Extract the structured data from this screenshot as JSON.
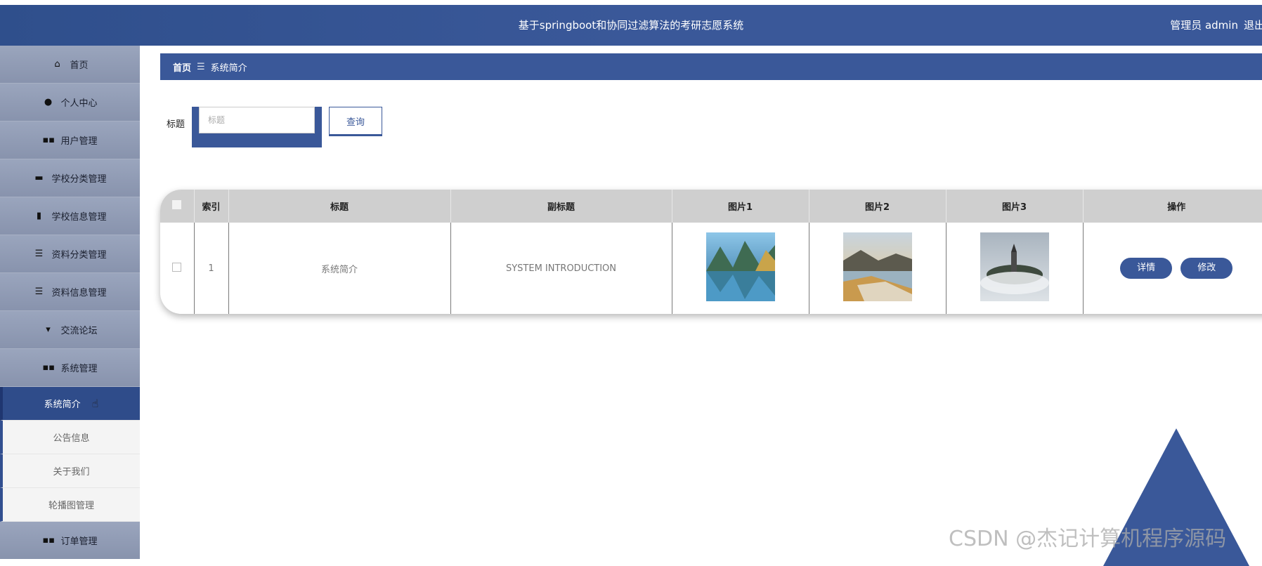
{
  "header": {
    "title": "基于springboot和协同过滤算法的考研志愿系统",
    "role": "管理员 admin",
    "logout": "退出"
  },
  "sidebar": {
    "items": [
      {
        "label": "首页",
        "icon": "home-icon"
      },
      {
        "label": "个人中心",
        "icon": "person-icon"
      },
      {
        "label": "用户管理",
        "icon": "grid-icon"
      },
      {
        "label": "学校分类管理",
        "icon": "ticket-icon"
      },
      {
        "label": "学校信息管理",
        "icon": "clipboard-icon"
      },
      {
        "label": "资料分类管理",
        "icon": "list-icon"
      },
      {
        "label": "资料信息管理",
        "icon": "list-icon"
      },
      {
        "label": "交流论坛",
        "icon": "forum-icon"
      },
      {
        "label": "系统管理",
        "icon": "grid-icon"
      }
    ],
    "sub_items": [
      {
        "label": "系统简介",
        "active": true
      },
      {
        "label": "公告信息",
        "active": false
      },
      {
        "label": "关于我们",
        "active": false
      },
      {
        "label": "轮播图管理",
        "active": false
      }
    ],
    "bottom_item": {
      "label": "订单管理",
      "icon": "grid-icon"
    }
  },
  "breadcrumb": {
    "home": "首页",
    "separator": "☰",
    "current": "系统简介"
  },
  "search": {
    "label": "标题",
    "placeholder": "标题",
    "button": "查询"
  },
  "table": {
    "headers": [
      "索引",
      "标题",
      "副标题",
      "图片1",
      "图片2",
      "图片3",
      "操作"
    ],
    "rows": [
      {
        "index": "1",
        "title": "系统简介",
        "subtitle": "SYSTEM INTRODUCTION",
        "images": [
          "lake-mountain-image",
          "coast-sunset-image",
          "island-castle-image"
        ],
        "actions": [
          "详情",
          "修改"
        ]
      }
    ]
  },
  "watermark": "CSDN @杰记计算机程序源码",
  "colors": {
    "primary": "#3a5899",
    "sidebar": "#8c97b0",
    "active": "#2f4c8a"
  }
}
